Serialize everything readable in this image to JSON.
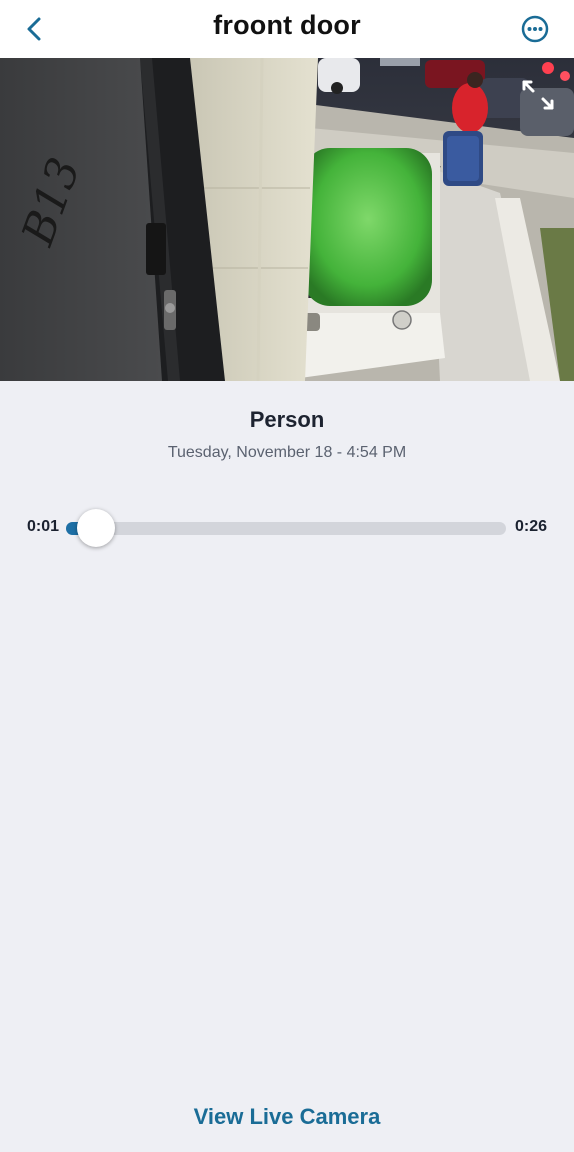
{
  "header": {
    "title": "froont door",
    "back_icon": "chevron-left-icon",
    "more_icon": "more-horizontal-circle-icon"
  },
  "video": {
    "door_number": "B13",
    "expand_icon": "expand-icon"
  },
  "event": {
    "type": "Person",
    "timestamp": "Tuesday, November 18 - 4:54 PM"
  },
  "scrubber": {
    "current_time": "0:01",
    "duration": "0:26",
    "progress": 0.04
  },
  "footer": {
    "live_link_label": "View Live Camera"
  },
  "colors": {
    "accent": "#1a6c96",
    "background": "#eeeff4",
    "track": "#d3d5db",
    "track_fill": "#1d6fa5"
  }
}
